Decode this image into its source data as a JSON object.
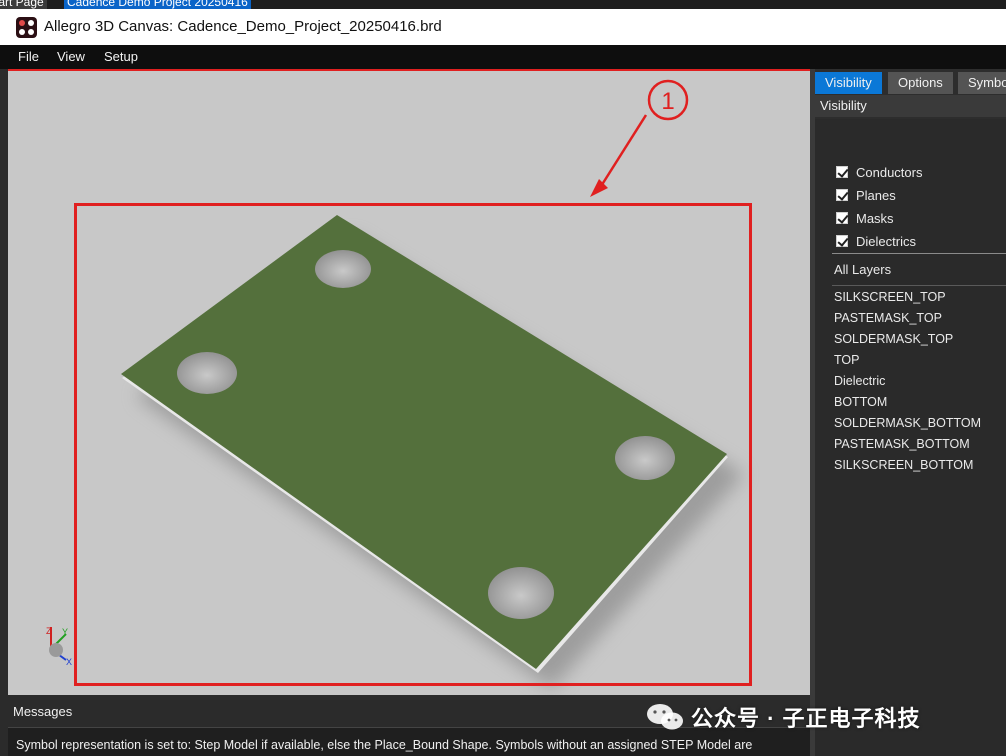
{
  "top_tabs": {
    "start_page": "tart Page",
    "project": "Cadence Demo Project 20250416"
  },
  "window": {
    "title": "Allegro 3D Canvas: Cadence_Demo_Project_20250416.brd"
  },
  "menu": {
    "items": [
      "File",
      "View",
      "Setup"
    ]
  },
  "annotation": {
    "marker": "1",
    "color": "#e02020"
  },
  "axes_gizmo": {
    "x": "X",
    "y": "Y",
    "z": "Z"
  },
  "panel": {
    "tabs": [
      "Visibility",
      "Options",
      "Symbo"
    ],
    "active_tab": "Visibility",
    "header": "Visibility",
    "checkboxes": [
      {
        "label": "Conductors",
        "checked": true
      },
      {
        "label": "Planes",
        "checked": true
      },
      {
        "label": "Masks",
        "checked": true
      },
      {
        "label": "Dielectrics",
        "checked": true
      }
    ],
    "all_layers_label": "All Layers",
    "layers": [
      "SILKSCREEN_TOP",
      "PASTEMASK_TOP",
      "SOLDERMASK_TOP",
      "TOP",
      "Dielectric",
      "BOTTOM",
      "SOLDERMASK_BOTTOM",
      "PASTEMASK_BOTTOM",
      "SILKSCREEN_BOTTOM"
    ]
  },
  "messages": {
    "title": "Messages",
    "text": "Symbol representation is set to: Step Model if available, else the Place_Bound Shape.  Symbols without an assigned STEP Model are"
  },
  "watermark": {
    "text": "公众号 · 子正电子科技",
    "close": "×"
  },
  "colors": {
    "board": "#54703c",
    "accent": "#0b78d7",
    "viewport_bg": "#c8c8c8"
  }
}
